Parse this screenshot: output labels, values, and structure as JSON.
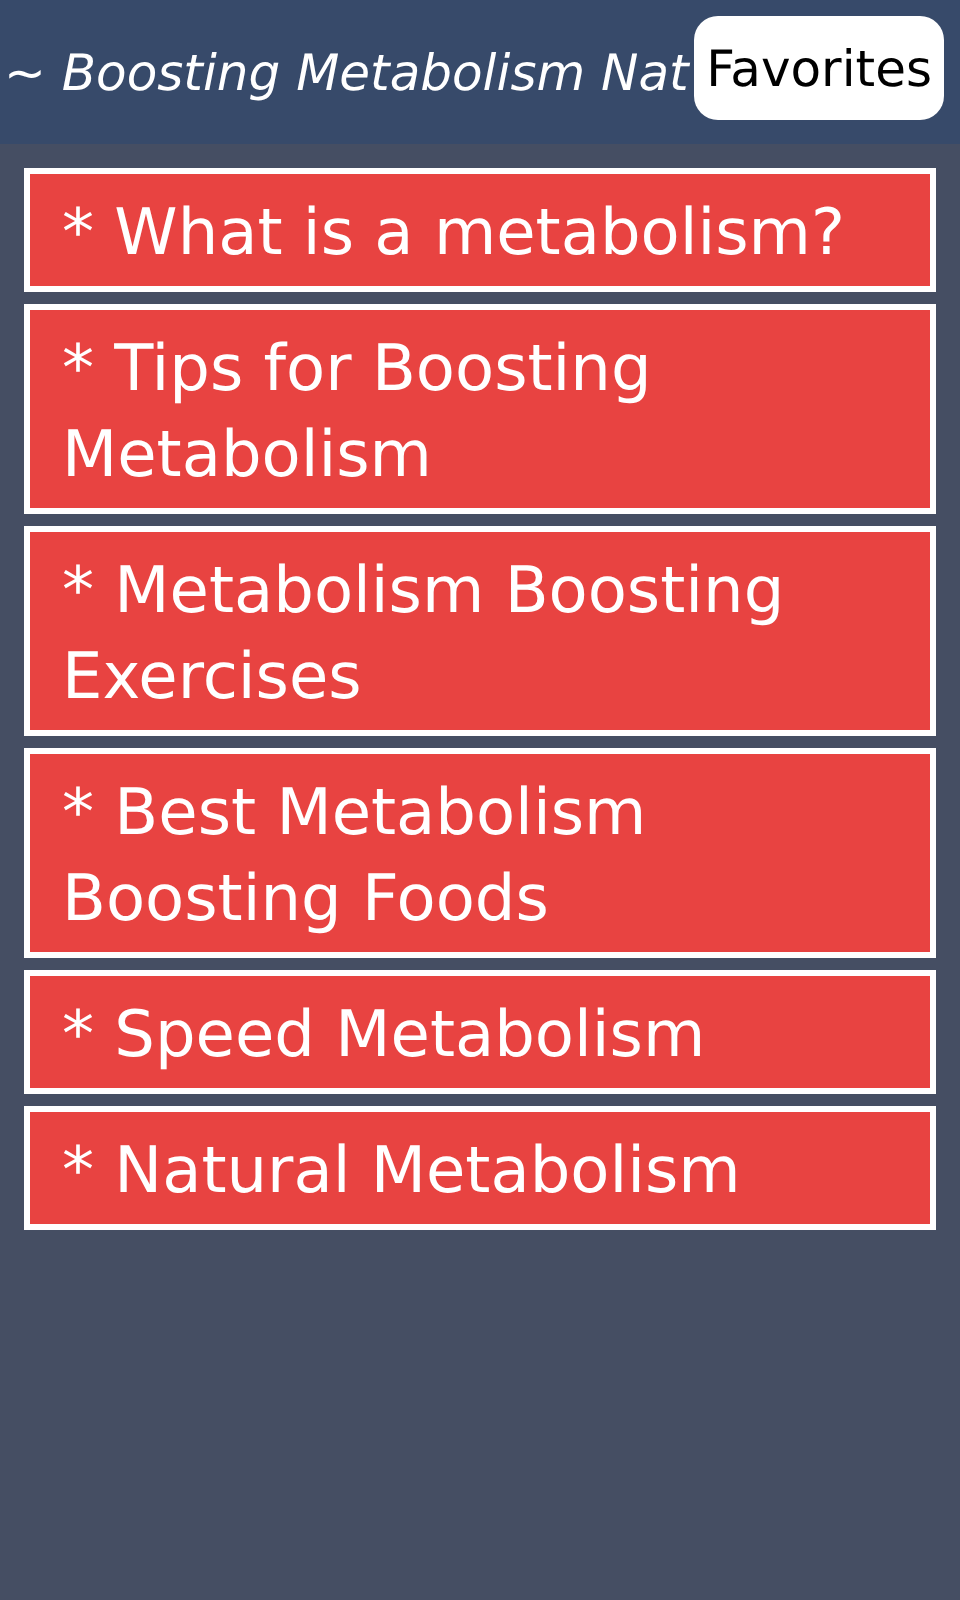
{
  "header": {
    "title": "~ Boosting Metabolism Nat",
    "button": "Favorites"
  },
  "items": [
    {
      "label": "* What is a metabolism?"
    },
    {
      "label": "* Tips for Boosting Metabolism"
    },
    {
      "label": "* Metabolism Boosting Exercises"
    },
    {
      "label": "* Best Metabolism Boosting Foods"
    },
    {
      "label": "* Speed Metabolism"
    },
    {
      "label": "* Natural Metabolism"
    }
  ]
}
